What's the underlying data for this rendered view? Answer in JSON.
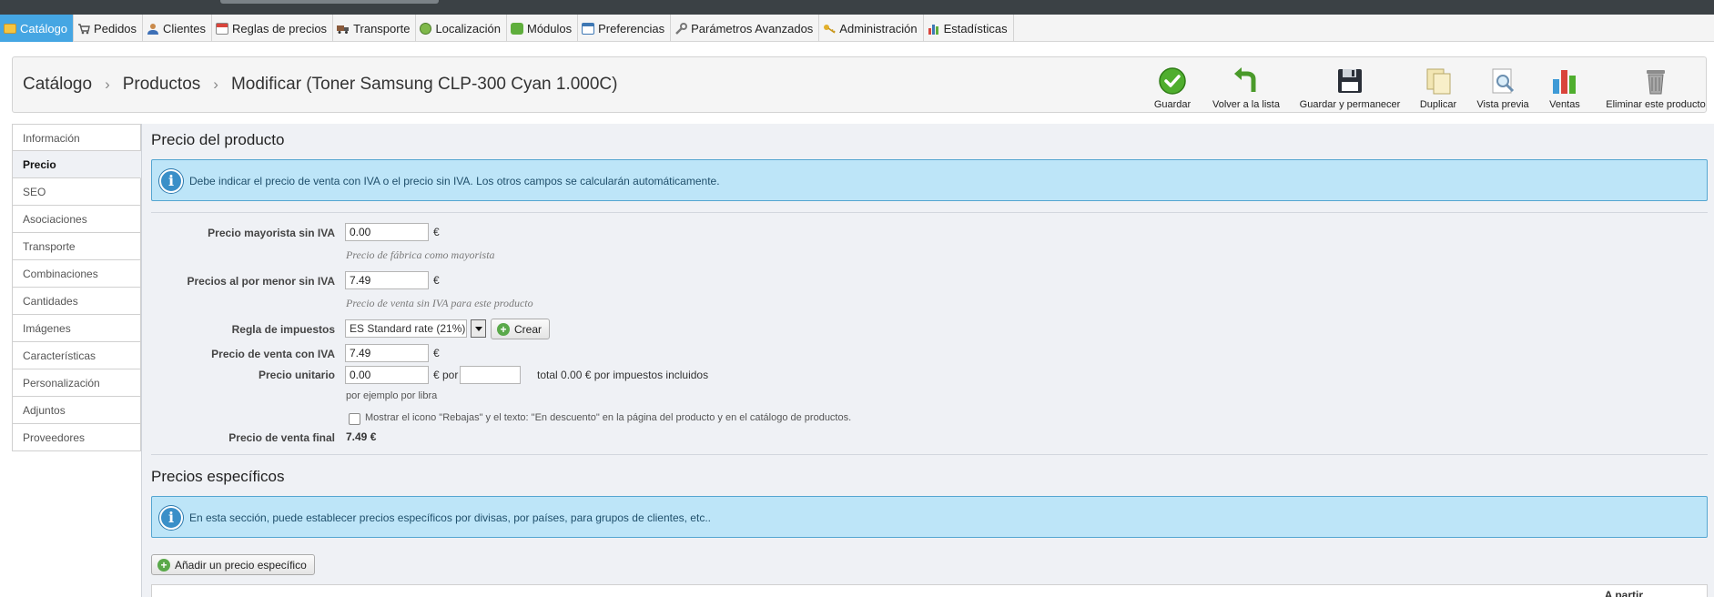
{
  "main_menu": {
    "items": [
      {
        "label": "Catálogo",
        "icon": "folder-icon"
      },
      {
        "label": "Pedidos",
        "icon": "cart-icon"
      },
      {
        "label": "Clientes",
        "icon": "user-icon"
      },
      {
        "label": "Reglas de precios",
        "icon": "calendar-icon"
      },
      {
        "label": "Transporte",
        "icon": "truck-icon"
      },
      {
        "label": "Localización",
        "icon": "globe-icon"
      },
      {
        "label": "Módulos",
        "icon": "puzzle-icon"
      },
      {
        "label": "Preferencias",
        "icon": "window-icon"
      },
      {
        "label": "Parámetros Avanzados",
        "icon": "wrench-icon"
      },
      {
        "label": "Administración",
        "icon": "key-icon"
      },
      {
        "label": "Estadísticas",
        "icon": "bar-chart-icon"
      }
    ]
  },
  "breadcrumb": {
    "level1": "Catálogo",
    "level2": "Productos",
    "level3": "Modificar (Toner Samsung CLP-300 Cyan 1.000C)",
    "separator": "›"
  },
  "toolbar": {
    "save": "Guardar",
    "back": "Volver a la lista",
    "save_stay": "Guardar y permanecer",
    "duplicate": "Duplicar",
    "preview": "Vista previa",
    "sales": "Ventas",
    "delete": "Eliminar este producto"
  },
  "sidebar": {
    "items": [
      "Información",
      "Precio",
      "SEO",
      "Asociaciones",
      "Transporte",
      "Combinaciones",
      "Cantidades",
      "Imágenes",
      "Características",
      "Personalización",
      "Adjuntos",
      "Proveedores"
    ]
  },
  "price_section": {
    "title": "Precio del producto",
    "info": "Debe indicar el precio de venta con IVA o el precio sin IVA. Los otros campos se calcularán automáticamente.",
    "wholesale": {
      "label": "Precio mayorista sin IVA",
      "value": "0.00",
      "currency": "€",
      "hint": "Precio de fábrica como mayorista"
    },
    "retail": {
      "label": "Precios al por menor sin IVA",
      "value": "7.49",
      "currency": "€",
      "hint": "Precio de venta sin IVA para este producto"
    },
    "tax_rule": {
      "label": "Regla de impuestos",
      "selected": "ES Standard rate (21%)",
      "create_button": "Crear"
    },
    "retail_with_tax": {
      "label": "Precio de venta con IVA",
      "value": "7.49",
      "currency": "€"
    },
    "unit_price": {
      "label": "Precio unitario",
      "value": "0.00",
      "per_text": "€ por",
      "unit_value": "",
      "total_text": "total 0.00 € por impuestos incluidos",
      "example": "por ejemplo por libra"
    },
    "on_sale": {
      "checked": false,
      "label": "Mostrar el icono \"Rebajas\" y el texto: \"En descuento\" en la página del producto y en el catálogo de productos."
    },
    "final_price": {
      "label": "Precio de venta final",
      "value": "7.49 €"
    }
  },
  "specific_prices": {
    "title": "Precios específicos",
    "info": "En esta sección, puede establecer precios específicos por divisas, por países, para grupos de clientes, etc..",
    "add_button": "Añadir un precio específico",
    "table_header_partial": "A partir"
  },
  "colors": {
    "accent": "#45a6e3",
    "info_bg": "#bde5f8",
    "info_border": "#55a6d1",
    "content_bg": "#eff1f5"
  }
}
